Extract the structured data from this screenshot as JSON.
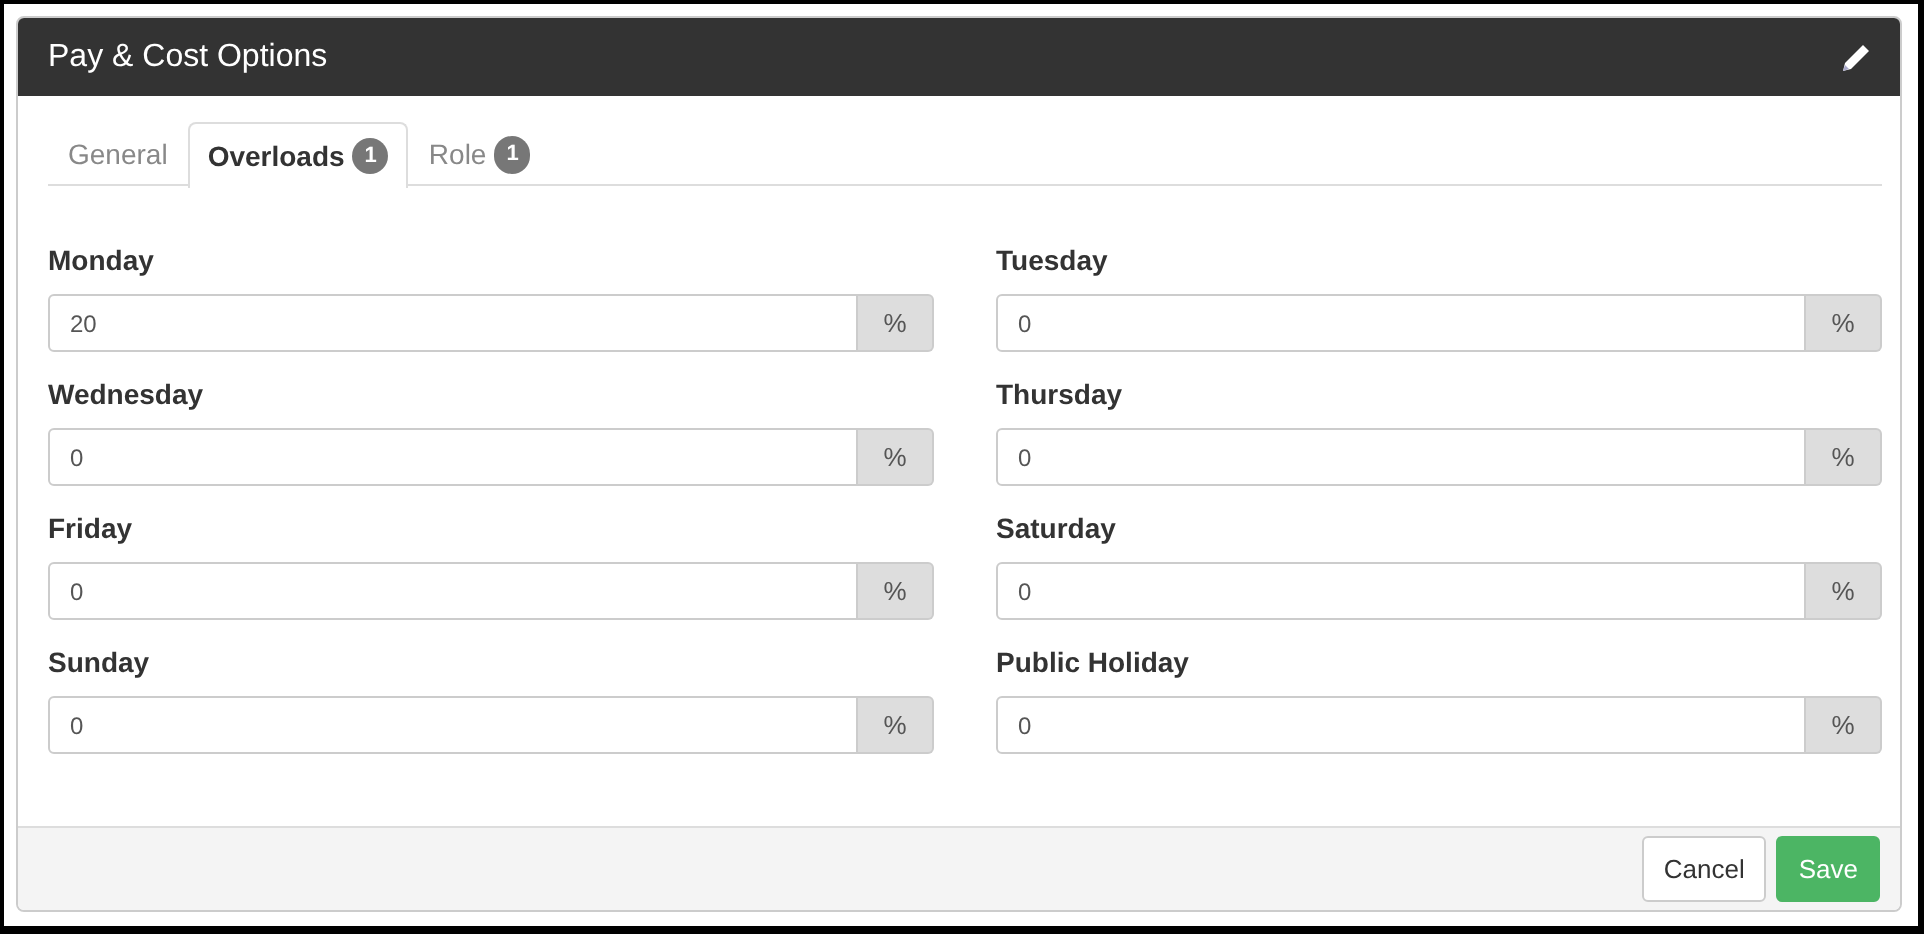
{
  "panel": {
    "title": "Pay & Cost Options"
  },
  "tabs": [
    {
      "label": "General",
      "selected": false
    },
    {
      "label": "Overloads",
      "badge": "1",
      "selected": true
    },
    {
      "label": "Role",
      "badge": "1",
      "selected": false
    }
  ],
  "fields": [
    {
      "label": "Monday",
      "value": "20",
      "unit": "%"
    },
    {
      "label": "Tuesday",
      "value": "0",
      "unit": "%"
    },
    {
      "label": "Wednesday",
      "value": "0",
      "unit": "%"
    },
    {
      "label": "Thursday",
      "value": "0",
      "unit": "%"
    },
    {
      "label": "Friday",
      "value": "0",
      "unit": "%"
    },
    {
      "label": "Saturday",
      "value": "0",
      "unit": "%"
    },
    {
      "label": "Sunday",
      "value": "0",
      "unit": "%"
    },
    {
      "label": "Public Holiday",
      "value": "0",
      "unit": "%"
    }
  ],
  "buttons": [
    {
      "label": "Cancel",
      "kind": "default"
    },
    {
      "label": "Save",
      "kind": "primary"
    }
  ]
}
